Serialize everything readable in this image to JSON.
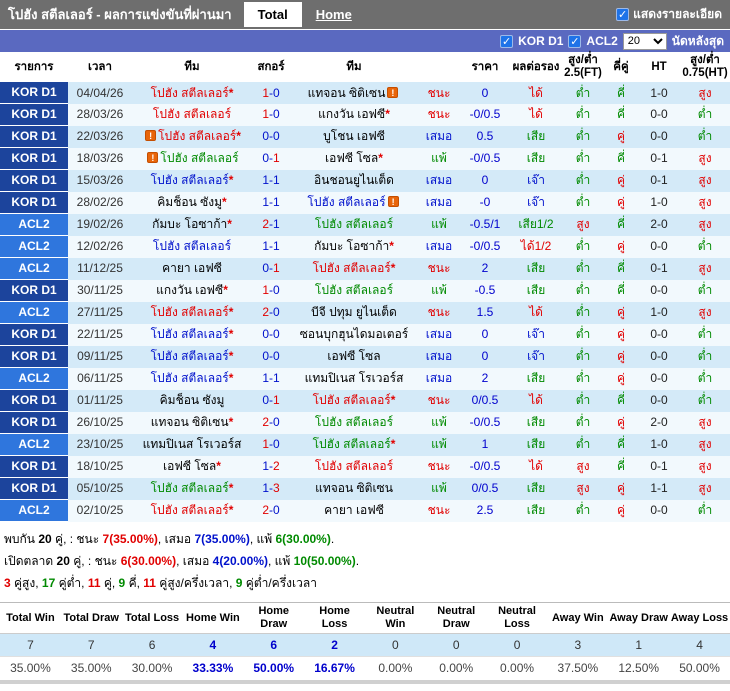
{
  "titlebar": {
    "title": "โปฮัง สตีลเลอร์ - ผลการแข่งขันที่ผ่านมา",
    "tabs": [
      {
        "label": "Total",
        "active": true
      },
      {
        "label": "Home",
        "active": false
      }
    ],
    "detail_checkbox_label": "แสดงรายละเอียด",
    "check_glyph": "✓"
  },
  "filterbar": {
    "leagues": [
      "KOR D1",
      "ACL2"
    ],
    "count_value": "20",
    "suffix_label": "นัดหลังสุด",
    "check_glyph": "✓"
  },
  "colors": {
    "win_red": "#e10000",
    "draw_blue": "#0011cc",
    "lose_green": "#008a00",
    "kor_badge": "#1c449c",
    "acl_badge": "#2f76dd",
    "bar_blue": "#5a69c0",
    "bar_gray": "#6e6e6e"
  },
  "table": {
    "headers": [
      "รายการ",
      "เวลา",
      "ทีม",
      "สกอร์",
      "ทีม",
      "",
      "ราคา",
      "ผลต่อรอง",
      "สูง/ต่ำ 2.5(FT)",
      "คี่คู่",
      "HT",
      "สูง/ต่ำ 0.75(HT)"
    ],
    "warn_icon_glyph": "!",
    "rows": [
      {
        "lg": "KOR D1",
        "lt": "kor",
        "date": "04/04/26",
        "home": {
          "t": "โปฮัง สตีลเลอร์",
          "c": "r",
          "star": true
        },
        "score": [
          "1",
          "0"
        ],
        "score_c": [
          "r",
          "b"
        ],
        "away": {
          "t": "แทจอน ซิติเซน",
          "c": "k",
          "icon": "a"
        },
        "res": {
          "t": "ชนะ",
          "c": "r"
        },
        "price": "0",
        "odds": {
          "t": "ได้",
          "c": "r"
        },
        "ou25": {
          "t": "ต่ำ",
          "c": "g"
        },
        "oe": {
          "t": "คี่",
          "c": "g"
        },
        "ht": "1-0",
        "ou075": {
          "t": "สูง",
          "c": "r"
        }
      },
      {
        "lg": "KOR D1",
        "lt": "kor",
        "date": "28/03/26",
        "home": {
          "t": "โปฮัง สตีลเลอร์",
          "c": "r"
        },
        "score": [
          "1",
          "0"
        ],
        "score_c": [
          "r",
          "b"
        ],
        "away": {
          "t": "แกงวัน เอฟซี",
          "c": "k",
          "star": true
        },
        "res": {
          "t": "ชนะ",
          "c": "r"
        },
        "price": "-0/0.5",
        "odds": {
          "t": "ได้",
          "c": "r"
        },
        "ou25": {
          "t": "ต่ำ",
          "c": "g"
        },
        "oe": {
          "t": "คี่",
          "c": "g"
        },
        "ht": "0-0",
        "ou075": {
          "t": "ต่ำ",
          "c": "g"
        }
      },
      {
        "lg": "KOR D1",
        "lt": "kor",
        "date": "22/03/26",
        "home": {
          "t": "โปฮัง สตีลเลอร์",
          "c": "r",
          "star": true,
          "icon": "b"
        },
        "score": [
          "0",
          "0"
        ],
        "score_c": [
          "b",
          "b"
        ],
        "away": {
          "t": "บูโชน เอฟซี",
          "c": "k"
        },
        "res": {
          "t": "เสมอ",
          "c": "b"
        },
        "price": "0.5",
        "odds": {
          "t": "เสีย",
          "c": "g"
        },
        "ou25": {
          "t": "ต่ำ",
          "c": "g"
        },
        "oe": {
          "t": "คู่",
          "c": "r"
        },
        "ht": "0-0",
        "ou075": {
          "t": "ต่ำ",
          "c": "g"
        }
      },
      {
        "lg": "KOR D1",
        "lt": "kor",
        "date": "18/03/26",
        "home": {
          "t": "โปฮัง สตีลเลอร์",
          "c": "g",
          "icon": "b"
        },
        "score": [
          "0",
          "1"
        ],
        "score_c": [
          "b",
          "r"
        ],
        "away": {
          "t": "เอฟซี โซล",
          "c": "k",
          "star": true
        },
        "res": {
          "t": "แพ้",
          "c": "g"
        },
        "price": "-0/0.5",
        "odds": {
          "t": "เสีย",
          "c": "g"
        },
        "ou25": {
          "t": "ต่ำ",
          "c": "g"
        },
        "oe": {
          "t": "คี่",
          "c": "g"
        },
        "ht": "0-1",
        "ou075": {
          "t": "สูง",
          "c": "r"
        }
      },
      {
        "lg": "KOR D1",
        "lt": "kor",
        "date": "15/03/26",
        "home": {
          "t": "โปฮัง สตีลเลอร์",
          "c": "b",
          "star": true
        },
        "score": [
          "1",
          "1"
        ],
        "score_c": [
          "b",
          "b"
        ],
        "away": {
          "t": "อินชอนยูไนเต็ด",
          "c": "k"
        },
        "res": {
          "t": "เสมอ",
          "c": "b"
        },
        "price": "0",
        "odds": {
          "t": "เจ๊า",
          "c": "b"
        },
        "ou25": {
          "t": "ต่ำ",
          "c": "g"
        },
        "oe": {
          "t": "คู่",
          "c": "r"
        },
        "ht": "0-1",
        "ou075": {
          "t": "สูง",
          "c": "r"
        }
      },
      {
        "lg": "KOR D1",
        "lt": "kor",
        "date": "28/02/26",
        "home": {
          "t": "คิมช็อน ซังมู",
          "c": "k",
          "star": true
        },
        "score": [
          "1",
          "1"
        ],
        "score_c": [
          "b",
          "b"
        ],
        "away": {
          "t": "โปฮัง สตีลเลอร์",
          "c": "b",
          "icon": "a"
        },
        "res": {
          "t": "เสมอ",
          "c": "b"
        },
        "price": "-0",
        "odds": {
          "t": "เจ๊า",
          "c": "b"
        },
        "ou25": {
          "t": "ต่ำ",
          "c": "g"
        },
        "oe": {
          "t": "คู่",
          "c": "r"
        },
        "ht": "1-0",
        "ou075": {
          "t": "สูง",
          "c": "r"
        }
      },
      {
        "lg": "ACL2",
        "lt": "acl",
        "date": "19/02/26",
        "home": {
          "t": "กัมบะ โอซาก้า",
          "c": "k",
          "star": true
        },
        "score": [
          "2",
          "1"
        ],
        "score_c": [
          "r",
          "b"
        ],
        "away": {
          "t": "โปฮัง สตีลเลอร์",
          "c": "g"
        },
        "res": {
          "t": "แพ้",
          "c": "g"
        },
        "price": "-0.5/1",
        "odds": {
          "t": "เสีย1/2",
          "c": "g"
        },
        "ou25": {
          "t": "สูง",
          "c": "r"
        },
        "oe": {
          "t": "คี่",
          "c": "g"
        },
        "ht": "2-0",
        "ou075": {
          "t": "สูง",
          "c": "r"
        }
      },
      {
        "lg": "ACL2",
        "lt": "acl",
        "date": "12/02/26",
        "home": {
          "t": "โปฮัง สตีลเลอร์",
          "c": "b"
        },
        "score": [
          "1",
          "1"
        ],
        "score_c": [
          "b",
          "b"
        ],
        "away": {
          "t": "กัมบะ โอซาก้า",
          "c": "k",
          "star": true
        },
        "res": {
          "t": "เสมอ",
          "c": "b"
        },
        "price": "-0/0.5",
        "odds": {
          "t": "ได้1/2",
          "c": "r"
        },
        "ou25": {
          "t": "ต่ำ",
          "c": "g"
        },
        "oe": {
          "t": "คู่",
          "c": "r"
        },
        "ht": "0-0",
        "ou075": {
          "t": "ต่ำ",
          "c": "g"
        }
      },
      {
        "lg": "ACL2",
        "lt": "acl",
        "date": "11/12/25",
        "home": {
          "t": "คายา เอฟซี",
          "c": "k"
        },
        "score": [
          "0",
          "1"
        ],
        "score_c": [
          "b",
          "r"
        ],
        "away": {
          "t": "โปฮัง สตีลเลอร์",
          "c": "r",
          "star": true
        },
        "res": {
          "t": "ชนะ",
          "c": "r"
        },
        "price": "2",
        "odds": {
          "t": "เสีย",
          "c": "g"
        },
        "ou25": {
          "t": "ต่ำ",
          "c": "g"
        },
        "oe": {
          "t": "คี่",
          "c": "g"
        },
        "ht": "0-1",
        "ou075": {
          "t": "สูง",
          "c": "r"
        }
      },
      {
        "lg": "KOR D1",
        "lt": "kor",
        "date": "30/11/25",
        "home": {
          "t": "แกงวัน เอฟซี",
          "c": "k",
          "star": true
        },
        "score": [
          "1",
          "0"
        ],
        "score_c": [
          "r",
          "b"
        ],
        "away": {
          "t": "โปฮัง สตีลเลอร์",
          "c": "g"
        },
        "res": {
          "t": "แพ้",
          "c": "g"
        },
        "price": "-0.5",
        "odds": {
          "t": "เสีย",
          "c": "g"
        },
        "ou25": {
          "t": "ต่ำ",
          "c": "g"
        },
        "oe": {
          "t": "คี่",
          "c": "g"
        },
        "ht": "0-0",
        "ou075": {
          "t": "ต่ำ",
          "c": "g"
        }
      },
      {
        "lg": "ACL2",
        "lt": "acl",
        "date": "27/11/25",
        "home": {
          "t": "โปฮัง สตีลเลอร์",
          "c": "r",
          "star": true
        },
        "score": [
          "2",
          "0"
        ],
        "score_c": [
          "r",
          "b"
        ],
        "away": {
          "t": "บีจี ปทุม ยูไนเต็ด",
          "c": "k"
        },
        "res": {
          "t": "ชนะ",
          "c": "r"
        },
        "price": "1.5",
        "odds": {
          "t": "ได้",
          "c": "r"
        },
        "ou25": {
          "t": "ต่ำ",
          "c": "g"
        },
        "oe": {
          "t": "คู่",
          "c": "r"
        },
        "ht": "1-0",
        "ou075": {
          "t": "สูง",
          "c": "r"
        }
      },
      {
        "lg": "KOR D1",
        "lt": "kor",
        "date": "22/11/25",
        "home": {
          "t": "โปฮัง สตีลเลอร์",
          "c": "b",
          "star": true
        },
        "score": [
          "0",
          "0"
        ],
        "score_c": [
          "b",
          "b"
        ],
        "away": {
          "t": "ซอนบุกฮุนไดมอเตอร์",
          "c": "k"
        },
        "res": {
          "t": "เสมอ",
          "c": "b"
        },
        "price": "0",
        "odds": {
          "t": "เจ๊า",
          "c": "b"
        },
        "ou25": {
          "t": "ต่ำ",
          "c": "g"
        },
        "oe": {
          "t": "คู่",
          "c": "r"
        },
        "ht": "0-0",
        "ou075": {
          "t": "ต่ำ",
          "c": "g"
        }
      },
      {
        "lg": "KOR D1",
        "lt": "kor",
        "date": "09/11/25",
        "home": {
          "t": "โปฮัง สตีลเลอร์",
          "c": "b",
          "star": true
        },
        "score": [
          "0",
          "0"
        ],
        "score_c": [
          "b",
          "b"
        ],
        "away": {
          "t": "เอฟซี โซล",
          "c": "k"
        },
        "res": {
          "t": "เสมอ",
          "c": "b"
        },
        "price": "0",
        "odds": {
          "t": "เจ๊า",
          "c": "b"
        },
        "ou25": {
          "t": "ต่ำ",
          "c": "g"
        },
        "oe": {
          "t": "คู่",
          "c": "r"
        },
        "ht": "0-0",
        "ou075": {
          "t": "ต่ำ",
          "c": "g"
        }
      },
      {
        "lg": "ACL2",
        "lt": "acl",
        "date": "06/11/25",
        "home": {
          "t": "โปฮัง สตีลเลอร์",
          "c": "b",
          "star": true
        },
        "score": [
          "1",
          "1"
        ],
        "score_c": [
          "b",
          "b"
        ],
        "away": {
          "t": "แทมปิเนส โรเวอร์ส",
          "c": "k"
        },
        "res": {
          "t": "เสมอ",
          "c": "b"
        },
        "price": "2",
        "odds": {
          "t": "เสีย",
          "c": "g"
        },
        "ou25": {
          "t": "ต่ำ",
          "c": "g"
        },
        "oe": {
          "t": "คู่",
          "c": "r"
        },
        "ht": "0-0",
        "ou075": {
          "t": "ต่ำ",
          "c": "g"
        }
      },
      {
        "lg": "KOR D1",
        "lt": "kor",
        "date": "01/11/25",
        "home": {
          "t": "คิมช็อน ซังมู",
          "c": "k"
        },
        "score": [
          "0",
          "1"
        ],
        "score_c": [
          "b",
          "r"
        ],
        "away": {
          "t": "โปฮัง สตีลเลอร์",
          "c": "r",
          "star": true
        },
        "res": {
          "t": "ชนะ",
          "c": "r"
        },
        "price": "0/0.5",
        "odds": {
          "t": "ได้",
          "c": "r"
        },
        "ou25": {
          "t": "ต่ำ",
          "c": "g"
        },
        "oe": {
          "t": "คี่",
          "c": "g"
        },
        "ht": "0-0",
        "ou075": {
          "t": "ต่ำ",
          "c": "g"
        }
      },
      {
        "lg": "KOR D1",
        "lt": "kor",
        "date": "26/10/25",
        "home": {
          "t": "แทจอน ซิติเซน",
          "c": "k",
          "star": true
        },
        "score": [
          "2",
          "0"
        ],
        "score_c": [
          "r",
          "b"
        ],
        "away": {
          "t": "โปฮัง สตีลเลอร์",
          "c": "g"
        },
        "res": {
          "t": "แพ้",
          "c": "g"
        },
        "price": "-0/0.5",
        "odds": {
          "t": "เสีย",
          "c": "g"
        },
        "ou25": {
          "t": "ต่ำ",
          "c": "g"
        },
        "oe": {
          "t": "คู่",
          "c": "r"
        },
        "ht": "2-0",
        "ou075": {
          "t": "สูง",
          "c": "r"
        }
      },
      {
        "lg": "ACL2",
        "lt": "acl",
        "date": "23/10/25",
        "home": {
          "t": "แทมปิเนส โรเวอร์ส",
          "c": "k"
        },
        "score": [
          "1",
          "0"
        ],
        "score_c": [
          "r",
          "b"
        ],
        "away": {
          "t": "โปฮัง สตีลเลอร์",
          "c": "g",
          "star": true
        },
        "res": {
          "t": "แพ้",
          "c": "g"
        },
        "price": "1",
        "odds": {
          "t": "เสีย",
          "c": "g"
        },
        "ou25": {
          "t": "ต่ำ",
          "c": "g"
        },
        "oe": {
          "t": "คี่",
          "c": "g"
        },
        "ht": "1-0",
        "ou075": {
          "t": "สูง",
          "c": "r"
        }
      },
      {
        "lg": "KOR D1",
        "lt": "kor",
        "date": "18/10/25",
        "home": {
          "t": "เอฟซี โซล",
          "c": "k",
          "star": true
        },
        "score": [
          "1",
          "2"
        ],
        "score_c": [
          "b",
          "r"
        ],
        "away": {
          "t": "โปฮัง สตีลเลอร์",
          "c": "r"
        },
        "res": {
          "t": "ชนะ",
          "c": "r"
        },
        "price": "-0/0.5",
        "odds": {
          "t": "ได้",
          "c": "r"
        },
        "ou25": {
          "t": "สูง",
          "c": "r"
        },
        "oe": {
          "t": "คี่",
          "c": "g"
        },
        "ht": "0-1",
        "ou075": {
          "t": "สูง",
          "c": "r"
        }
      },
      {
        "lg": "KOR D1",
        "lt": "kor",
        "date": "05/10/25",
        "home": {
          "t": "โปฮัง สตีลเลอร์",
          "c": "g",
          "star": true
        },
        "score": [
          "1",
          "3"
        ],
        "score_c": [
          "b",
          "r"
        ],
        "away": {
          "t": "แทจอน ซิติเซน",
          "c": "k"
        },
        "res": {
          "t": "แพ้",
          "c": "g"
        },
        "price": "0/0.5",
        "odds": {
          "t": "เสีย",
          "c": "g"
        },
        "ou25": {
          "t": "สูง",
          "c": "r"
        },
        "oe": {
          "t": "คู่",
          "c": "r"
        },
        "ht": "1-1",
        "ou075": {
          "t": "สูง",
          "c": "r"
        }
      },
      {
        "lg": "ACL2",
        "lt": "acl",
        "date": "02/10/25",
        "home": {
          "t": "โปฮัง สตีลเลอร์",
          "c": "r",
          "star": true
        },
        "score": [
          "2",
          "0"
        ],
        "score_c": [
          "r",
          "b"
        ],
        "away": {
          "t": "คายา เอฟซี",
          "c": "k"
        },
        "res": {
          "t": "ชนะ",
          "c": "r"
        },
        "price": "2.5",
        "odds": {
          "t": "เสีย",
          "c": "g"
        },
        "ou25": {
          "t": "ต่ำ",
          "c": "g"
        },
        "oe": {
          "t": "คู่",
          "c": "r"
        },
        "ht": "0-0",
        "ou075": {
          "t": "ต่ำ",
          "c": "g"
        }
      }
    ]
  },
  "summary": {
    "line1": [
      {
        "t": "พบกัน ",
        "c": "k"
      },
      {
        "t": "20",
        "c": "k",
        "bold": true
      },
      {
        "t": " คู่, : ชนะ ",
        "c": "k"
      },
      {
        "t": "7(35.00%)",
        "c": "r",
        "bold": true
      },
      {
        "t": ", เสมอ ",
        "c": "k"
      },
      {
        "t": "7(35.00%)",
        "c": "b",
        "bold": true
      },
      {
        "t": ", แพ้ ",
        "c": "k"
      },
      {
        "t": "6(30.00%)",
        "c": "g",
        "bold": true
      },
      {
        "t": ".",
        "c": "k"
      }
    ],
    "line2": [
      {
        "t": "เปิดตลาด ",
        "c": "k"
      },
      {
        "t": "20",
        "c": "k",
        "bold": true
      },
      {
        "t": " คู่, : ชนะ ",
        "c": "k"
      },
      {
        "t": "6(30.00%)",
        "c": "r",
        "bold": true
      },
      {
        "t": ", เสมอ ",
        "c": "k"
      },
      {
        "t": "4(20.00%)",
        "c": "b",
        "bold": true
      },
      {
        "t": ", แพ้ ",
        "c": "k"
      },
      {
        "t": "10(50.00%)",
        "c": "g",
        "bold": true
      },
      {
        "t": ".",
        "c": "k"
      }
    ],
    "line3": [
      {
        "t": "3",
        "c": "r",
        "bold": true
      },
      {
        "t": " คู่สูง, ",
        "c": "k"
      },
      {
        "t": "17",
        "c": "g",
        "bold": true
      },
      {
        "t": " คู่ต่ำ, ",
        "c": "k"
      },
      {
        "t": "11",
        "c": "r",
        "bold": true
      },
      {
        "t": " คู่, ",
        "c": "k"
      },
      {
        "t": "9",
        "c": "g",
        "bold": true
      },
      {
        "t": " คี่, ",
        "c": "k"
      },
      {
        "t": "11",
        "c": "r",
        "bold": true
      },
      {
        "t": " คู่สูง/ครึ่งเวลา, ",
        "c": "k"
      },
      {
        "t": "9",
        "c": "g",
        "bold": true
      },
      {
        "t": " คู่ต่ำ/ครึ่งเวลา",
        "c": "k"
      }
    ]
  },
  "bottom_table": {
    "headers": [
      "Total Win",
      "Total Draw",
      "Total Loss",
      "Home Win",
      "Home Draw",
      "Home Loss",
      "Neutral Win",
      "Neutral Draw",
      "Neutral Loss",
      "Away Win",
      "Away Draw",
      "Away Loss"
    ],
    "counts": [
      "7",
      "7",
      "6",
      "4",
      "6",
      "2",
      "0",
      "0",
      "0",
      "3",
      "1",
      "4"
    ],
    "percents": [
      "35.00%",
      "35.00%",
      "30.00%",
      "33.33%",
      "50.00%",
      "16.67%",
      "0.00%",
      "0.00%",
      "0.00%",
      "37.50%",
      "12.50%",
      "50.00%"
    ],
    "home_columns": [
      3,
      4,
      5
    ]
  }
}
